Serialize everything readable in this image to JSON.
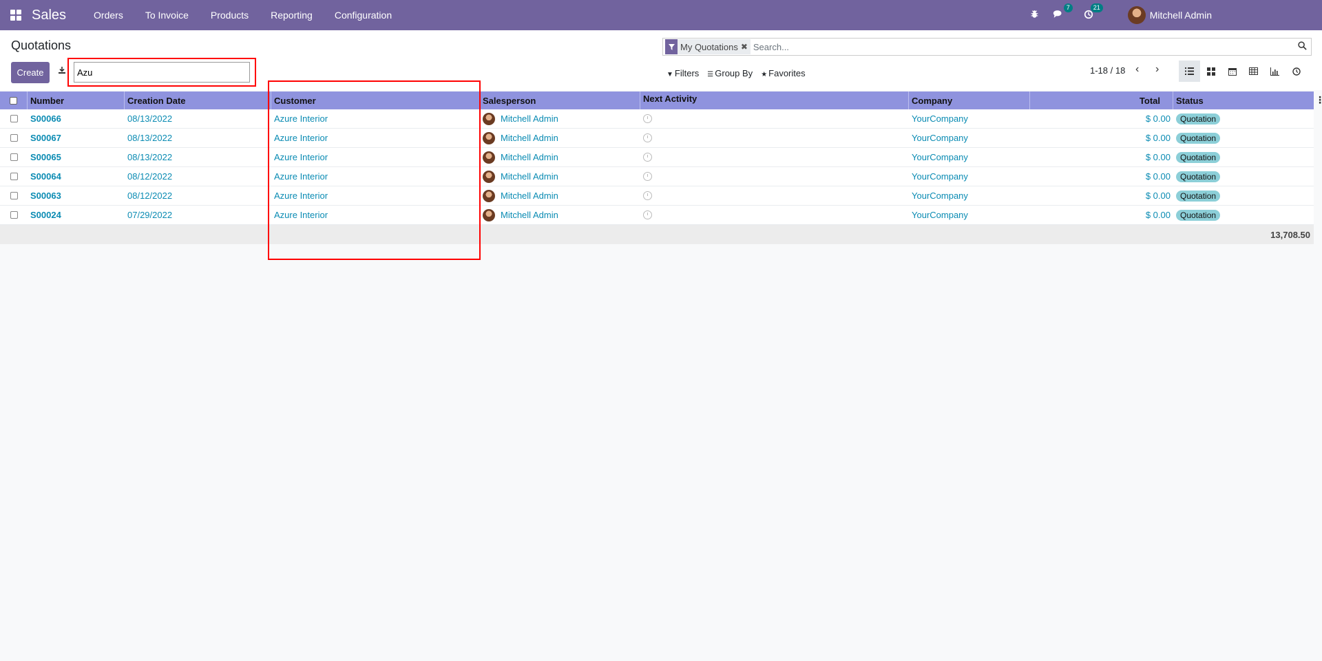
{
  "navbar": {
    "app_name": "Sales",
    "menu": [
      "Orders",
      "To Invoice",
      "Products",
      "Reporting",
      "Configuration"
    ],
    "messages_count": "7",
    "activities_count": "21",
    "user_name": "Mitchell Admin",
    "color": "#71639e"
  },
  "control": {
    "title": "Quotations",
    "create_label": "Create",
    "quick_input_value": "Azu",
    "search_placeholder": "Search...",
    "facet_label": "My Quotations",
    "filters_label": "Filters",
    "groupby_label": "Group By",
    "favorites_label": "Favorites",
    "pager": "1-18 / 18"
  },
  "table": {
    "headers": {
      "number": "Number",
      "creation_date": "Creation Date",
      "customer": "Customer",
      "salesperson": "Salesperson",
      "next_activity": "Next Activity",
      "company": "Company",
      "total": "Total",
      "status": "Status"
    },
    "rows": [
      {
        "number": "S00066",
        "date": "08/13/2022",
        "customer": "Azure Interior",
        "salesperson": "Mitchell Admin",
        "company": "YourCompany",
        "total": "$ 0.00",
        "status": "Quotation"
      },
      {
        "number": "S00067",
        "date": "08/13/2022",
        "customer": "Azure Interior",
        "salesperson": "Mitchell Admin",
        "company": "YourCompany",
        "total": "$ 0.00",
        "status": "Quotation"
      },
      {
        "number": "S00065",
        "date": "08/13/2022",
        "customer": "Azure Interior",
        "salesperson": "Mitchell Admin",
        "company": "YourCompany",
        "total": "$ 0.00",
        "status": "Quotation"
      },
      {
        "number": "S00064",
        "date": "08/12/2022",
        "customer": "Azure Interior",
        "salesperson": "Mitchell Admin",
        "company": "YourCompany",
        "total": "$ 0.00",
        "status": "Quotation"
      },
      {
        "number": "S00063",
        "date": "08/12/2022",
        "customer": "Azure Interior",
        "salesperson": "Mitchell Admin",
        "company": "YourCompany",
        "total": "$ 0.00",
        "status": "Quotation"
      },
      {
        "number": "S00024",
        "date": "07/29/2022",
        "customer": "Azure Interior",
        "salesperson": "Mitchell Admin",
        "company": "YourCompany",
        "total": "$ 0.00",
        "status": "Quotation"
      }
    ],
    "footer_total": "13,708.50"
  }
}
